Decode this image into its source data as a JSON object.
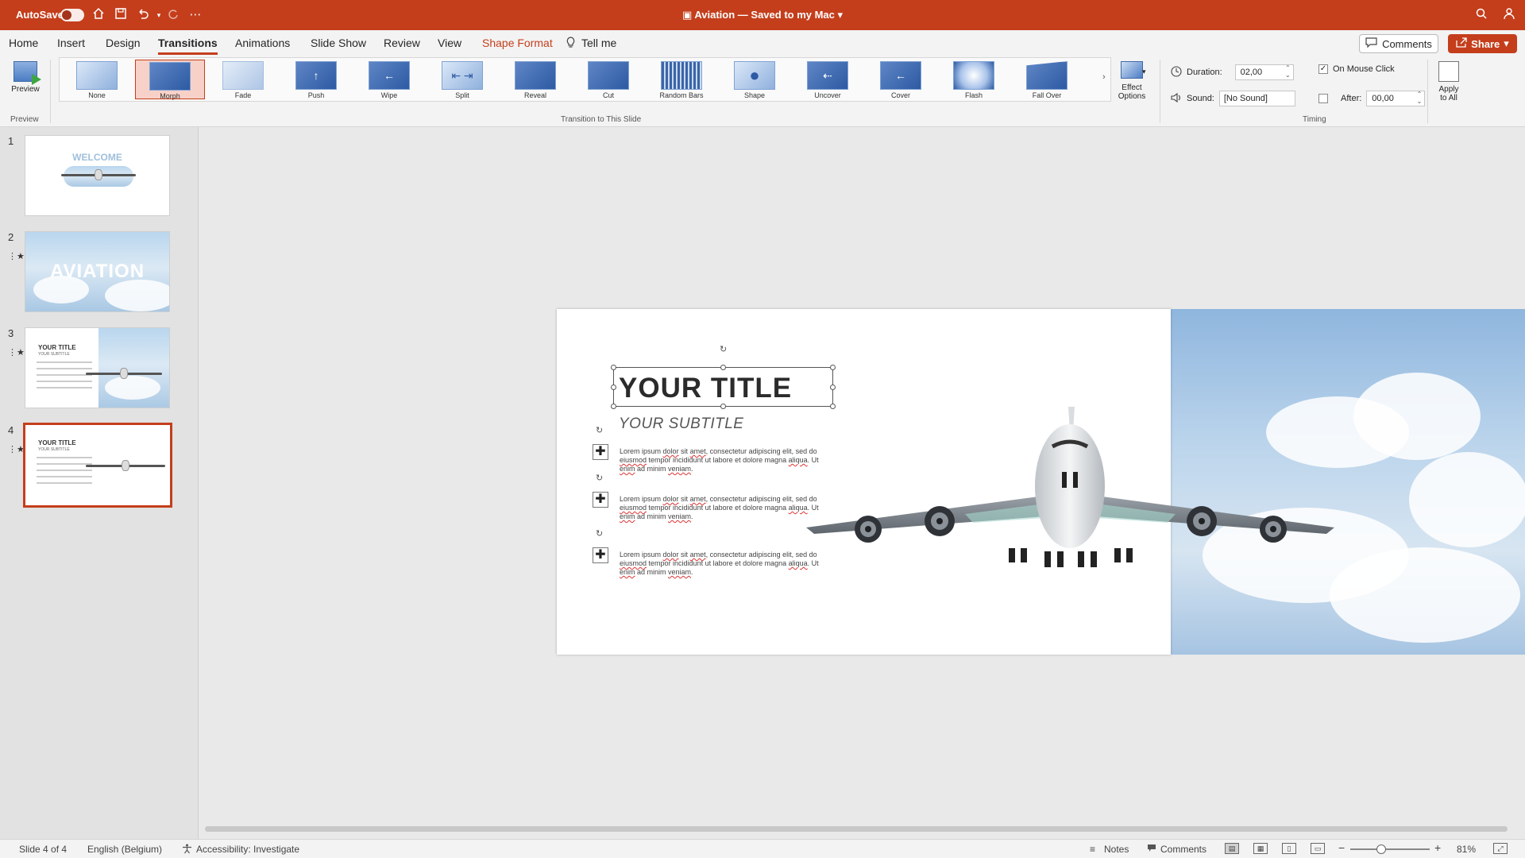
{
  "titlebar": {
    "autosave_label": "AutoSave",
    "document_title": "Aviation — Saved to my Mac",
    "icons": [
      "home-icon",
      "save-icon",
      "undo-icon",
      "redo-icon",
      "more-icon",
      "search-icon",
      "account-icon"
    ]
  },
  "tabs": [
    {
      "label": "Home"
    },
    {
      "label": "Insert"
    },
    {
      "label": "Design"
    },
    {
      "label": "Transitions"
    },
    {
      "label": "Animations"
    },
    {
      "label": "Slide Show"
    },
    {
      "label": "Review"
    },
    {
      "label": "View"
    },
    {
      "label": "Shape Format"
    },
    {
      "label": "Tell me"
    }
  ],
  "header_buttons": {
    "comments": "Comments",
    "share": "Share"
  },
  "ribbon": {
    "preview_label": "Preview",
    "preview_group": "Preview",
    "transitions_group": "Transition to This Slide",
    "timing_group": "Timing",
    "transitions": [
      {
        "label": "None"
      },
      {
        "label": "Morph"
      },
      {
        "label": "Fade"
      },
      {
        "label": "Push"
      },
      {
        "label": "Wipe"
      },
      {
        "label": "Split"
      },
      {
        "label": "Reveal"
      },
      {
        "label": "Cut"
      },
      {
        "label": "Random Bars"
      },
      {
        "label": "Shape"
      },
      {
        "label": "Uncover"
      },
      {
        "label": "Cover"
      },
      {
        "label": "Flash"
      },
      {
        "label": "Fall Over"
      }
    ],
    "selected_transition": "Morph",
    "effect_options_line1": "Effect",
    "effect_options_line2": "Options",
    "duration_label": "Duration:",
    "duration_value": "02,00",
    "sound_label": "Sound:",
    "sound_value": "[No Sound]",
    "on_mouse_click_label": "On Mouse Click",
    "on_mouse_click_checked": true,
    "after_label": "After:",
    "after_value": "00,00",
    "after_checked": false,
    "apply_all_line1": "Apply",
    "apply_all_line2": "to All"
  },
  "slides_panel": {
    "slides": [
      {
        "number": "1",
        "starred": false,
        "title": "WELCOME"
      },
      {
        "number": "2",
        "starred": true,
        "title": "AVIATION"
      },
      {
        "number": "3",
        "starred": true,
        "title": "YOUR TITLE",
        "subtitle": "YOUR SUBTITLE"
      },
      {
        "number": "4",
        "starred": true,
        "title": "YOUR TITLE",
        "subtitle": "YOUR SUBTITLE"
      }
    ],
    "selected_slide": "4"
  },
  "slide": {
    "title": "YOUR TITLE",
    "subtitle": "YOUR SUBTITLE",
    "bullets": [
      {
        "text_a": "Lorem ipsum ",
        "sq1": "dolor",
        "text_b": " sit ",
        "sq2": "amet",
        "text_c": ", consectetur adipiscing elit, sed do ",
        "sq3": "eiusmod",
        "text_d": " tempor incididunt ut labore et dolore magna ",
        "sq4": "aliqua",
        "text_e": ". Ut ",
        "sq5": "enim",
        "text_f": " ad minim ",
        "sq6": "veniam",
        "text_g": "."
      },
      {
        "text_a": "Lorem ipsum ",
        "sq1": "dolor",
        "text_b": " sit ",
        "sq2": "amet",
        "text_c": ", consectetur adipiscing elit, sed do ",
        "sq3": "eiusmod",
        "text_d": " tempor incididunt ut labore et dolore magna ",
        "sq4": "aliqua",
        "text_e": ". Ut ",
        "sq5": "enim",
        "text_f": " ad minim ",
        "sq6": "veniam",
        "text_g": "."
      },
      {
        "text_a": "Lorem ipsum ",
        "sq1": "dolor",
        "text_b": " sit ",
        "sq2": "amet",
        "text_c": ", consectetur adipiscing elit, sed do ",
        "sq3": "eiusmod",
        "text_d": " tempor incididunt ut labore et dolore magna ",
        "sq4": "aliqua",
        "text_e": ". Ut ",
        "sq5": "enim",
        "text_f": " ad minim ",
        "sq6": "veniam",
        "text_g": "."
      }
    ]
  },
  "statusbar": {
    "slide_counter": "Slide 4 of 4",
    "language": "English (Belgium)",
    "accessibility": "Accessibility: Investigate",
    "notes": "Notes",
    "comments": "Comments",
    "zoom": "81%"
  },
  "colors": {
    "accent": "#c43e1c",
    "ribbon_bg": "#f3f3f3",
    "canvas_bg": "#e9e9e9"
  }
}
